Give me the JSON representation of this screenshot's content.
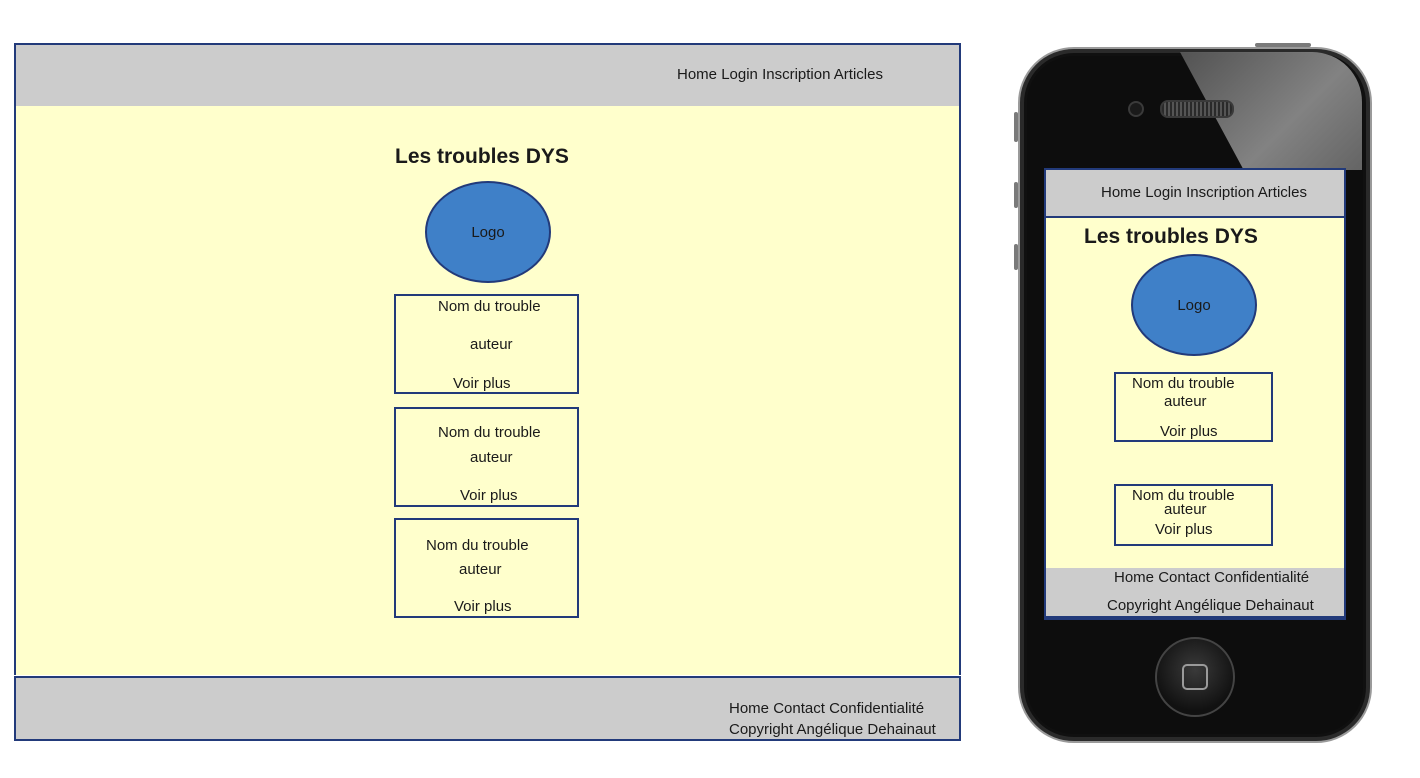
{
  "desktop": {
    "nav": [
      "Home",
      "Login",
      "Inscription",
      "Articles"
    ],
    "title": "Les troubles DYS",
    "logo": "Logo",
    "cards": [
      {
        "name": "Nom du trouble",
        "author": "auteur",
        "more": "Voir plus"
      },
      {
        "name": "Nom du trouble",
        "author": "auteur",
        "more": "Voir plus"
      },
      {
        "name": "Nom du trouble",
        "author": "auteur",
        "more": "Voir plus"
      }
    ],
    "footer": {
      "links": [
        "Home",
        "Contact",
        "Confidentialité"
      ],
      "copyright": "Copyright Angélique Dehainaut"
    }
  },
  "mobile": {
    "nav": [
      "Home",
      "Login",
      "Inscription",
      "Articles"
    ],
    "title": "Les troubles DYS",
    "logo": "Logo",
    "cards": [
      {
        "name": "Nom du trouble",
        "author": "auteur",
        "more": "Voir plus"
      },
      {
        "name": "Nom du trouble",
        "author": "auteur",
        "more": "Voir plus"
      }
    ],
    "footer": {
      "links": [
        "Home",
        "Contact",
        "Confidentialité"
      ],
      "copyright": "Copyright Angélique Dehainaut"
    }
  }
}
